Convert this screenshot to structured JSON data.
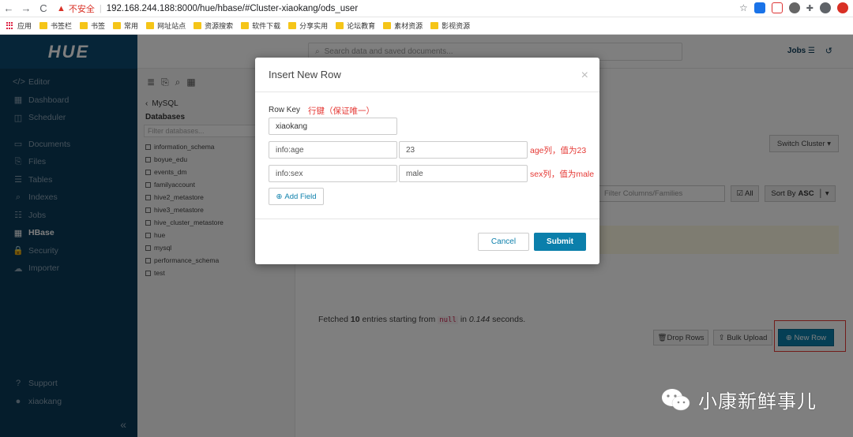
{
  "browser": {
    "back_glyph": "←",
    "forward_glyph": "→",
    "reload_glyph": "C",
    "security_warning": "不安全",
    "url": "192.168.244.188:8000/hue/hbase/#Cluster-xiaokang/ods_user",
    "bookmarks": [
      "应用",
      "书签栏",
      "书签",
      "常用",
      "网址站点",
      "资源搜索",
      "软件下载",
      "分享实用",
      "论坛教育",
      "素材资源",
      "影视资源"
    ]
  },
  "sidebar": {
    "logo": "HUE",
    "items": [
      {
        "icon": "</>",
        "label": "Editor"
      },
      {
        "icon": "▦",
        "label": "Dashboard"
      },
      {
        "icon": "◫",
        "label": "Scheduler"
      },
      {
        "icon": "▭",
        "label": "Documents"
      },
      {
        "icon": "⎘",
        "label": "Files"
      },
      {
        "icon": "☰",
        "label": "Tables"
      },
      {
        "icon": "⌕",
        "label": "Indexes"
      },
      {
        "icon": "☷",
        "label": "Jobs"
      },
      {
        "icon": "▦",
        "label": "HBase"
      },
      {
        "icon": "🔒",
        "label": "Security"
      },
      {
        "icon": "☁",
        "label": "Importer"
      }
    ],
    "support": "Support",
    "user": "xiaokang",
    "collapse_glyph": "«"
  },
  "topbar": {
    "search_placeholder": "Search data and saved documents...",
    "jobs": "Jobs"
  },
  "db_panel": {
    "crumb": "MySQL",
    "title": "Databases",
    "filter_placeholder": "Filter databases...",
    "databases": [
      "information_schema",
      "boyue_edu",
      "events_dm",
      "familyaccount",
      "hive2_metastore",
      "hive3_metastore",
      "hive_cluster_metastore",
      "hue",
      "mysql",
      "performance_schema",
      "test"
    ]
  },
  "main": {
    "switch_cluster": "Switch Cluster",
    "filter_placeholder": "Filter Columns/Families",
    "all_label": "All",
    "sort_prefix": "Sort By",
    "sort_value": "ASC",
    "fetched_pre": "Fetched",
    "fetched_count": "10",
    "fetched_mid": "entries starting from",
    "fetched_null": "null",
    "fetched_in": "in",
    "fetched_time": "0.144",
    "fetched_post": "seconds.",
    "drop_rows": "Drop Rows",
    "bulk_upload": "Bulk Upload",
    "new_row": "New Row"
  },
  "modal": {
    "title": "Insert New Row",
    "close_glyph": "×",
    "row_key_label": "Row Key",
    "row_key_note": "行键（保证唯一）",
    "row_key_value": "xiaokang",
    "fields": [
      {
        "column": "info:age",
        "value": "23",
        "note": "age列，值为23"
      },
      {
        "column": "info:sex",
        "value": "male",
        "note": "sex列，值为male"
      }
    ],
    "add_field": "Add Field",
    "cancel": "Cancel",
    "submit": "Submit"
  },
  "watermark": {
    "text": "小康新鲜事儿"
  },
  "colors": {
    "nav_bg": "#0b3a58",
    "primary": "#0b7fab",
    "annotation_red": "#e53935"
  }
}
